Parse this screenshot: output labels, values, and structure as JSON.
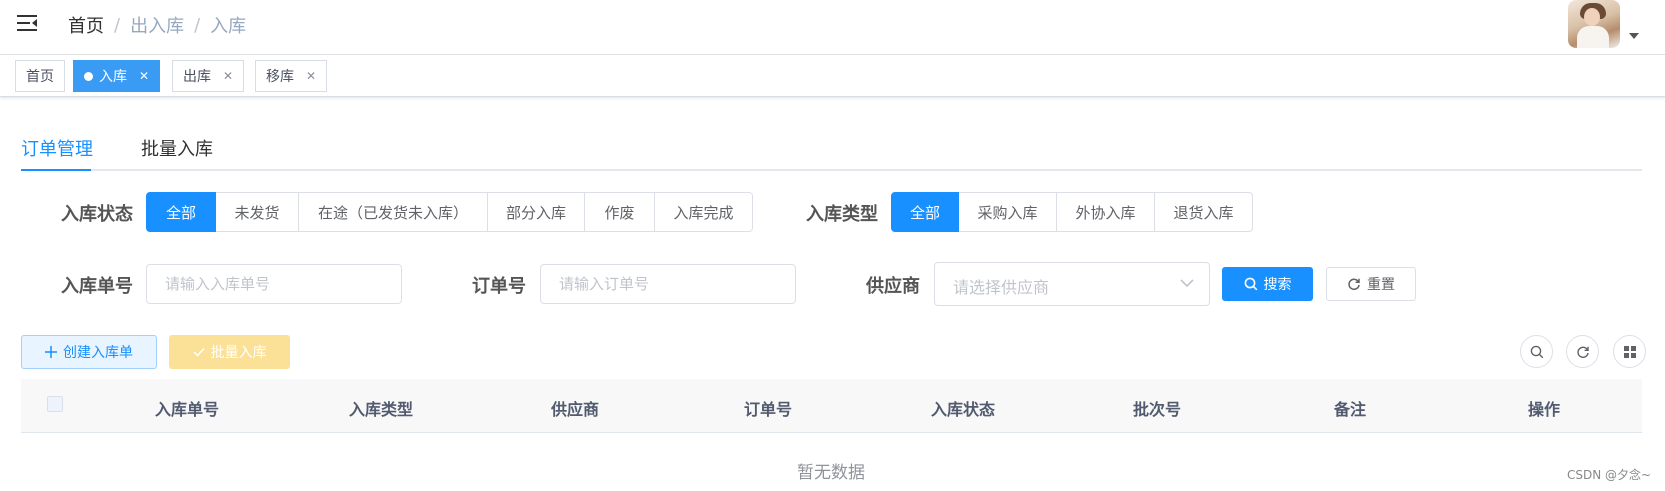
{
  "navbar": {
    "breadcrumb": {
      "home": "首页",
      "parent": "出入库",
      "current": "入库",
      "separator": "/"
    }
  },
  "tags": [
    {
      "label": "首页",
      "active": false,
      "closable": false
    },
    {
      "label": "入库",
      "active": true,
      "closable": true
    },
    {
      "label": "出库",
      "active": false,
      "closable": true
    },
    {
      "label": "移库",
      "active": false,
      "closable": true
    }
  ],
  "tabs": [
    {
      "label": "订单管理",
      "active": true
    },
    {
      "label": "批量入库",
      "active": false
    }
  ],
  "filters": {
    "status_label": "入库状态",
    "status_options": [
      "全部",
      "未发货",
      "在途（已发货未入库）",
      "部分入库",
      "作废",
      "入库完成"
    ],
    "status_selected": "全部",
    "type_label": "入库类型",
    "type_options": [
      "全部",
      "采购入库",
      "外协入库",
      "退货入库"
    ],
    "type_selected": "全部",
    "receipt_no_label": "入库单号",
    "receipt_no_placeholder": "请输入入库单号",
    "order_no_label": "订单号",
    "order_no_placeholder": "请输入订单号",
    "supplier_label": "供应商",
    "supplier_placeholder": "请选择供应商",
    "search_label": "搜索",
    "reset_label": "重置"
  },
  "toolbar": {
    "create_label": "创建入库单",
    "batch_label": "批量入库"
  },
  "table": {
    "columns": [
      "入库单号",
      "入库类型",
      "供应商",
      "订单号",
      "入库状态",
      "批次号",
      "备注",
      "操作"
    ],
    "empty_text": "暂无数据"
  },
  "watermark": "CSDN @夕念~",
  "colors": {
    "primary": "#1890ff",
    "warning_disabled": "#fbe198",
    "tag_active": "#3a9bf5"
  }
}
